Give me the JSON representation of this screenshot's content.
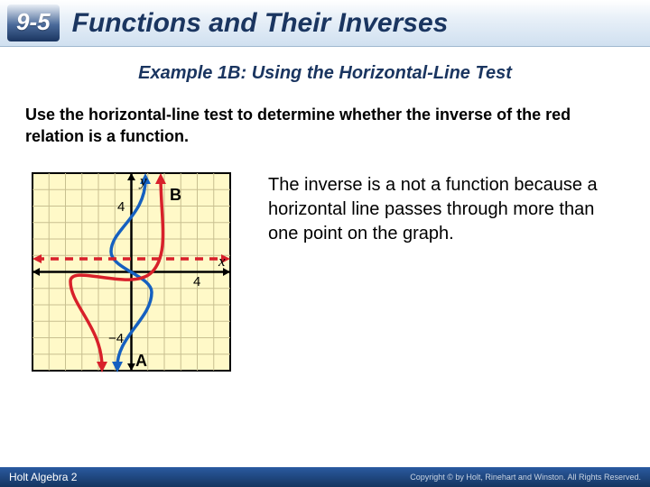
{
  "header": {
    "lesson_number": "9-5",
    "lesson_title": "Functions and Their Inverses"
  },
  "example": {
    "heading": "Example 1B: Using the Horizontal-Line Test",
    "prompt": "Use the horizontal-line test to determine whether the inverse of the red relation is a function.",
    "answer": "The inverse is a not a function because a horizontal line passes through more than one point on the graph."
  },
  "graph": {
    "x_axis_label": "x",
    "y_axis_label": "y",
    "tick_pos": "4",
    "tick_neg": "−4",
    "curve_labels": {
      "blue": "A",
      "red": "B"
    },
    "x_range": "[-6, 6]",
    "y_range": "[-6, 6]",
    "dashed_line_y": "approx 1"
  },
  "footer": {
    "book": "Holt Algebra 2",
    "copyright": "Copyright © by Holt, Rinehart and Winston. All Rights Reserved."
  }
}
